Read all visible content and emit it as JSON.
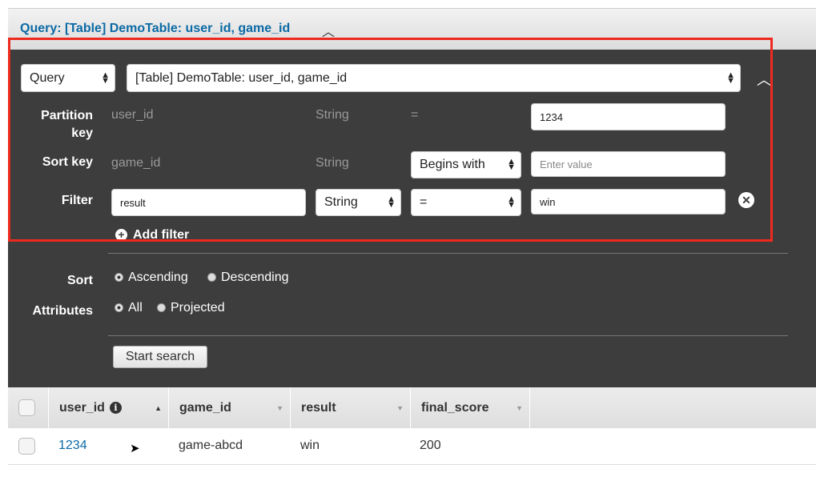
{
  "header": {
    "title": "Query: [Table] DemoTable: user_id, game_id"
  },
  "query": {
    "mode": "Query",
    "target": "[Table] DemoTable: user_id, game_id",
    "partition_key": {
      "label": "Partition key",
      "label_line1": "Partition",
      "label_line2": "key",
      "name": "user_id",
      "type": "String",
      "operator": "=",
      "value": "1234"
    },
    "sort_key": {
      "label": "Sort key",
      "name": "game_id",
      "type": "String",
      "operator": "Begins with",
      "placeholder": "Enter value"
    },
    "filter": {
      "label": "Filter",
      "attribute": "result",
      "type": "String",
      "operator": "=",
      "value": "win"
    },
    "add_filter": "Add filter",
    "sort": {
      "label": "Sort",
      "options": [
        "Ascending",
        "Descending"
      ],
      "selected": "Ascending"
    },
    "attributes": {
      "label": "Attributes",
      "options": [
        "All",
        "Projected"
      ],
      "selected": "All"
    },
    "start_search": "Start search"
  },
  "table": {
    "columns": [
      "user_id",
      "game_id",
      "result",
      "final_score"
    ],
    "rows": [
      [
        "1234",
        "game-abcd",
        "win",
        "200"
      ]
    ]
  },
  "colors": {
    "accent": "#0b6aa5",
    "panel": "#3d3d3d",
    "highlight": "#ee2a1e"
  }
}
